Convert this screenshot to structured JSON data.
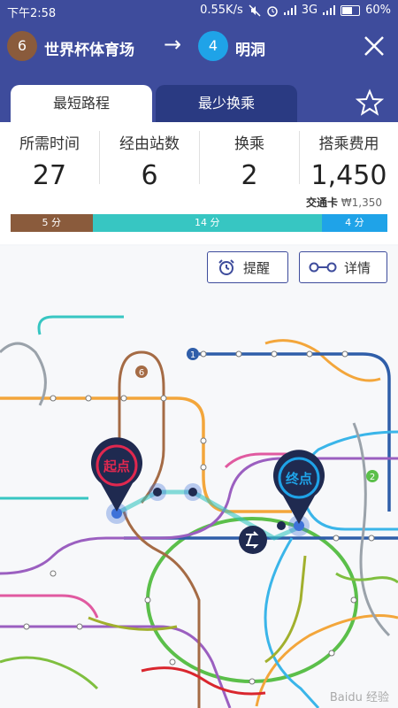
{
  "status_bar": {
    "time": "下午2:58",
    "speed": "0.55K/s",
    "network": "3G",
    "battery": "60%",
    "battery_level": 0.6
  },
  "route": {
    "origin": {
      "line": "6",
      "name": "世界杯体育场",
      "color": "#8a5b3c"
    },
    "destination": {
      "line": "4",
      "name": "明洞",
      "color": "#1fa3e8"
    },
    "arrow": "→"
  },
  "tabs": [
    {
      "label": "最短路程",
      "active": true
    },
    {
      "label": "最少换乘",
      "active": false
    }
  ],
  "summary": {
    "time": {
      "label": "所需时间",
      "value": "27"
    },
    "stations": {
      "label": "经由站数",
      "value": "6"
    },
    "transfers": {
      "label": "换乘",
      "value": "2"
    },
    "fare": {
      "label": "搭乘费用",
      "value": "1,450"
    },
    "card_fee": {
      "label": "交通卡",
      "value": "₩1,350"
    }
  },
  "segments": [
    {
      "label": "5 分",
      "minutes": 5,
      "color": "#8a5b3c"
    },
    {
      "label": "14 分",
      "minutes": 14,
      "color": "#37c6c2"
    },
    {
      "label": "4 分",
      "minutes": 4,
      "color": "#1fa3e8"
    }
  ],
  "actions": {
    "reminder": "提醒",
    "details": "详情"
  },
  "map": {
    "start_label": "起点",
    "end_label": "终点",
    "start_color": "#e0284f",
    "end_color": "#1fa3e8",
    "station_badge_1": "1",
    "station_badge_2": "2",
    "station_badge_6": "6",
    "watermark": "Baidu 经验"
  }
}
